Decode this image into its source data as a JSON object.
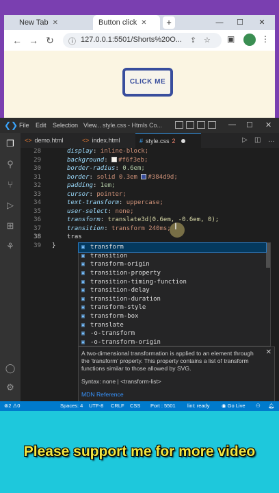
{
  "browser": {
    "tabs": [
      {
        "label": "New Tab"
      },
      {
        "label": "Button click"
      }
    ],
    "url": "127.0.0.1:5501/Shorts%20O...",
    "demo_button_label": "CLICK ME"
  },
  "vscode": {
    "menu": [
      "File",
      "Edit",
      "Selection",
      "View"
    ],
    "window_title": "style.css - Htmls Co...",
    "editor_tabs": [
      {
        "label": "demo.html",
        "active": false
      },
      {
        "label": "index.html",
        "active": false
      },
      {
        "label": "style.css",
        "badge": "2",
        "active": true,
        "dirty": true
      }
    ],
    "code_lines": [
      {
        "num": "28",
        "prop": "display",
        "value": " inline-block;"
      },
      {
        "num": "29",
        "prop": "background",
        "value": "#f6f3eb;",
        "swatch": "#f6f3eb"
      },
      {
        "num": "30",
        "prop": "border-radius",
        "value": " 0.6em;"
      },
      {
        "num": "31",
        "prop": "border",
        "value_pre": " solid 0.3em ",
        "value": "#384d9d;",
        "swatch": "#384d9d"
      },
      {
        "num": "32",
        "prop": "padding",
        "value": " 1em;"
      },
      {
        "num": "33",
        "prop": "cursor",
        "value": " pointer;"
      },
      {
        "num": "34",
        "prop": "text-transform",
        "value": " uppercase;"
      },
      {
        "num": "35",
        "prop": "user-select",
        "value": " none;"
      },
      {
        "num": "36",
        "prop": "transform",
        "value": " translate3d(0.6em, -0.6em, 0);"
      },
      {
        "num": "37",
        "prop": "transition",
        "value": " transform 240ms;"
      },
      {
        "num": "38",
        "prop": "tras",
        "value": ""
      },
      {
        "num": "39",
        "prop": "",
        "value": "}"
      }
    ],
    "suggestions": [
      "transform",
      "transition",
      "transform-origin",
      "transition-property",
      "transition-timing-function",
      "transition-delay",
      "transition-duration",
      "transform-style",
      "transform-box",
      "translate",
      "-o-transform",
      "-o-transform-origin"
    ],
    "docs": {
      "text": "A two-dimensional transformation is applied to an element through the 'transform' property. This property contains a list of transform functions similar to those allowed by SVG.",
      "syntax": "Syntax: none | <transform-list>",
      "link": "MDN Reference"
    },
    "status": {
      "errors": "2",
      "warnings": "0",
      "spaces": "Spaces: 4",
      "encoding": "UTF-8",
      "eol": "CRLF",
      "language": "CSS",
      "port": "Port : 5501",
      "lint": "lint: ready",
      "golive": "Go Live"
    }
  },
  "caption": "Please support me for more video"
}
